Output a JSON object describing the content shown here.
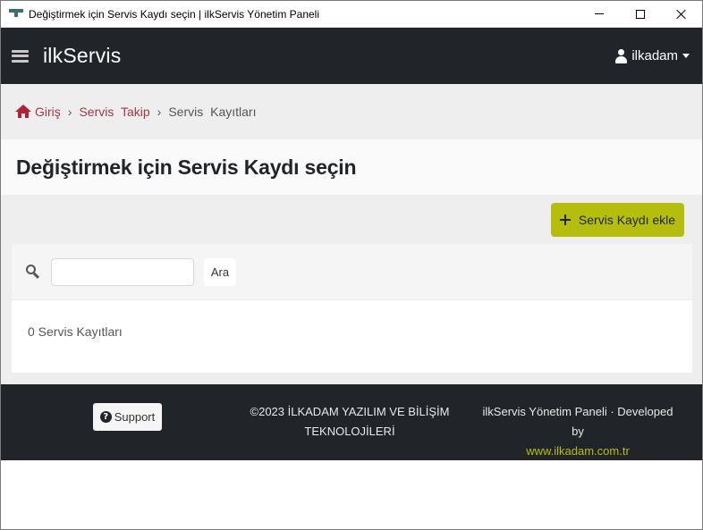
{
  "window": {
    "title": "Değiştirmek için Servis Kaydı seçin | ilkServis Yönetim Paneli"
  },
  "navbar": {
    "brand": "ilkServis",
    "user": "ilkadam"
  },
  "breadcrumb": {
    "home": "Giriş",
    "separator": "›",
    "section": "Servis Takip",
    "current": "Servis Kayıtları"
  },
  "page": {
    "title": "Değiştirmek için Servis Kaydı seçin"
  },
  "actions": {
    "add_label": "Servis Kaydı ekle"
  },
  "search": {
    "value": "",
    "placeholder": "",
    "button_label": "Ara"
  },
  "results": {
    "count_text": "0 Servis Kayıtları"
  },
  "footer": {
    "support_label": "Support",
    "copyright_line1": "©2023 İLKADAM YAZILIM VE BİLİŞİM",
    "copyright_line2": "TEKNOLOJİLERİ",
    "credits_text": "ilkServis Yönetim Paneli · Developed by",
    "credits_link": "www.ilkadam.com.tr"
  },
  "colors": {
    "navbar": "#212529",
    "accent": "#b5be0d",
    "link": "#a03847",
    "home_icon": "#b22234"
  }
}
